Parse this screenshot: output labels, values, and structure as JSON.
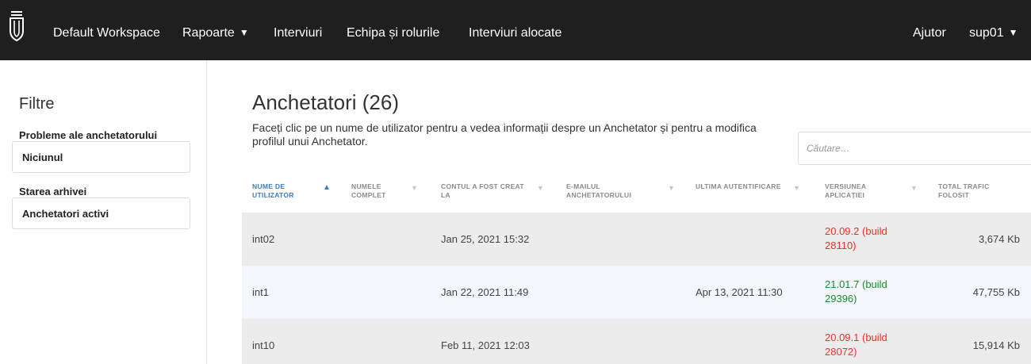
{
  "nav": {
    "workspace": "Default Workspace",
    "reports": "Rapoarte",
    "interviews": "Interviuri",
    "team": "Echipa și rolurile",
    "assigned": "Interviuri alocate",
    "help": "Ajutor",
    "user": "sup01"
  },
  "sidebar": {
    "title": "Filtre",
    "filter1_label": "Probleme ale anchetatorului",
    "filter1_value": "Niciunul",
    "filter2_label": "Starea arhivei",
    "filter2_value": "Anchetatori activi"
  },
  "main": {
    "title": "Anchetatori (26)",
    "description": "Faceți clic pe un nume de utilizator pentru a vedea informații despre un Anchetator și pentru a modifica profilul unui Anchetator.",
    "search_placeholder": "Căutare…"
  },
  "table": {
    "headers": [
      "NUME DE UTILIZATOR",
      "NUMELE COMPLET",
      "CONTUL A FOST CREAT LA",
      "E-MAILUL ANCHETATORULUI",
      "ULTIMA AUTENTIFICARE",
      "VERSIUNEA APLICAȚIEI",
      "TOTAL TRAFIC FOLOSIT"
    ],
    "rows": [
      {
        "username": "int02",
        "created": "Jan 25, 2021 15:32",
        "last_login": "",
        "version": "20.09.2 (build 28110)",
        "version_status": "outdated",
        "traffic": "3,674 Kb"
      },
      {
        "username": "int1",
        "created": "Jan 22, 2021 11:49",
        "last_login": "Apr 13, 2021 11:30",
        "version": "21.01.7 (build 29396)",
        "version_status": "current",
        "traffic": "47,755 Kb"
      },
      {
        "username": "int10",
        "created": "Feb 11, 2021 12:03",
        "last_login": "",
        "version": "20.09.1 (build 28072)",
        "version_status": "outdated",
        "traffic": "15,914 Kb"
      }
    ]
  },
  "colors": {
    "topbar": "#1f1f1f",
    "accent": "#3b7bbf",
    "outdated": "#e8322b",
    "current": "#1f8a2c"
  }
}
